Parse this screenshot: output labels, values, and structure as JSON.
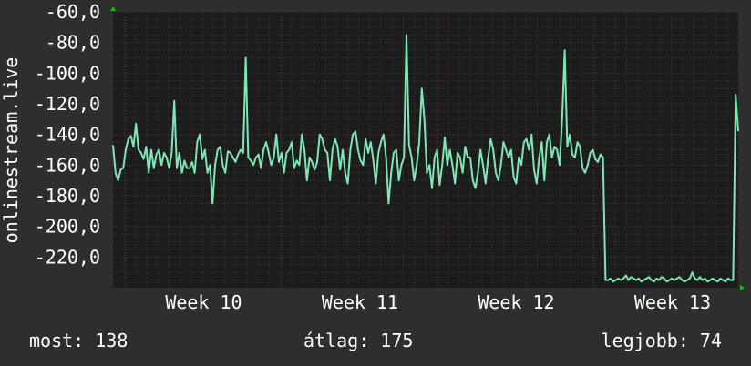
{
  "colors": {
    "background": "#2e2e2e",
    "plot_background": "#1c1c1c",
    "grid": "#3a3a3a",
    "grid_major": "#5a3030",
    "line": "#7fe6b4",
    "axis_arrow": "#00cc00",
    "text": "#ffffff"
  },
  "stats": {
    "current": "most: 138",
    "average": "átlag: 175",
    "best": "legjobb: 74"
  },
  "chart_data": {
    "type": "line",
    "ylabel": "onlinestream.live",
    "xlabel": "",
    "title": "",
    "ylim": [
      -240,
      -60
    ],
    "xlim": [
      0,
      1
    ],
    "yticks": [
      {
        "value": -60,
        "label": "-60,0"
      },
      {
        "value": -80,
        "label": "-80,0"
      },
      {
        "value": -100,
        "label": "-100,0"
      },
      {
        "value": -120,
        "label": "-120,0"
      },
      {
        "value": -140,
        "label": "-140,0"
      },
      {
        "value": -160,
        "label": "-160,0"
      },
      {
        "value": -180,
        "label": "-180,0"
      },
      {
        "value": -200,
        "label": "-200,0"
      },
      {
        "value": -220,
        "label": "-220,0"
      }
    ],
    "xticks": [
      {
        "value": 0.145,
        "label": "Week 10"
      },
      {
        "value": 0.395,
        "label": "Week 11"
      },
      {
        "value": 0.645,
        "label": "Week 12"
      },
      {
        "value": 0.895,
        "label": "Week 13"
      }
    ],
    "week_boundaries": [
      0.02,
      0.27,
      0.52,
      0.77
    ],
    "grid": true,
    "series": [
      {
        "values": [
          -147,
          -165,
          -170,
          -163,
          -162,
          -150,
          -143,
          -141,
          -148,
          -133,
          -150,
          -152,
          -156,
          -148,
          -165,
          -150,
          -162,
          -153,
          -150,
          -160,
          -152,
          -155,
          -162,
          -152,
          -118,
          -162,
          -152,
          -165,
          -157,
          -162,
          -162,
          -158,
          -165,
          -145,
          -140,
          -156,
          -150,
          -165,
          -160,
          -185,
          -160,
          -150,
          -148,
          -160,
          -165,
          -151,
          -152,
          -155,
          -158,
          -153,
          -150,
          -152,
          -90,
          -155,
          -157,
          -160,
          -155,
          -153,
          -162,
          -150,
          -145,
          -152,
          -160,
          -155,
          -140,
          -158,
          -152,
          -165,
          -152,
          -150,
          -145,
          -162,
          -157,
          -160,
          -140,
          -150,
          -170,
          -155,
          -158,
          -163,
          -158,
          -140,
          -143,
          -150,
          -152,
          -170,
          -150,
          -143,
          -148,
          -163,
          -150,
          -165,
          -172,
          -150,
          -140,
          -138,
          -150,
          -157,
          -160,
          -143,
          -152,
          -145,
          -157,
          -172,
          -152,
          -145,
          -140,
          -155,
          -185,
          -165,
          -152,
          -150,
          -170,
          -160,
          -155,
          -75,
          -147,
          -155,
          -170,
          -160,
          -145,
          -110,
          -130,
          -165,
          -160,
          -175,
          -155,
          -150,
          -173,
          -160,
          -142,
          -160,
          -150,
          -160,
          -172,
          -152,
          -155,
          -165,
          -148,
          -155,
          -155,
          -170,
          -175,
          -165,
          -150,
          -160,
          -172,
          -155,
          -143,
          -150,
          -165,
          -170,
          -160,
          -145,
          -150,
          -155,
          -150,
          -168,
          -172,
          -155,
          -160,
          -145,
          -143,
          -150,
          -140,
          -163,
          -172,
          -155,
          -145,
          -170,
          -145,
          -140,
          -155,
          -148,
          -150,
          -160,
          -130,
          -85,
          -148,
          -140,
          -153,
          -155,
          -145,
          -148,
          -162,
          -165,
          -160,
          -152,
          -150,
          -156,
          -158,
          -153,
          -155,
          -235,
          -235,
          -234,
          -236,
          -235,
          -234,
          -235,
          -234,
          -232,
          -235,
          -233,
          -234,
          -235,
          -234,
          -236,
          -235,
          -234,
          -233,
          -235,
          -236,
          -234,
          -235,
          -233,
          -234,
          -236,
          -235,
          -234,
          -235,
          -234,
          -233,
          -235,
          -236,
          -235,
          -234,
          -230,
          -234,
          -235,
          -233,
          -235,
          -234,
          -236,
          -235,
          -234,
          -235,
          -236,
          -234,
          -235,
          -236,
          -234,
          -235,
          -235,
          -114,
          -138
        ]
      }
    ]
  }
}
